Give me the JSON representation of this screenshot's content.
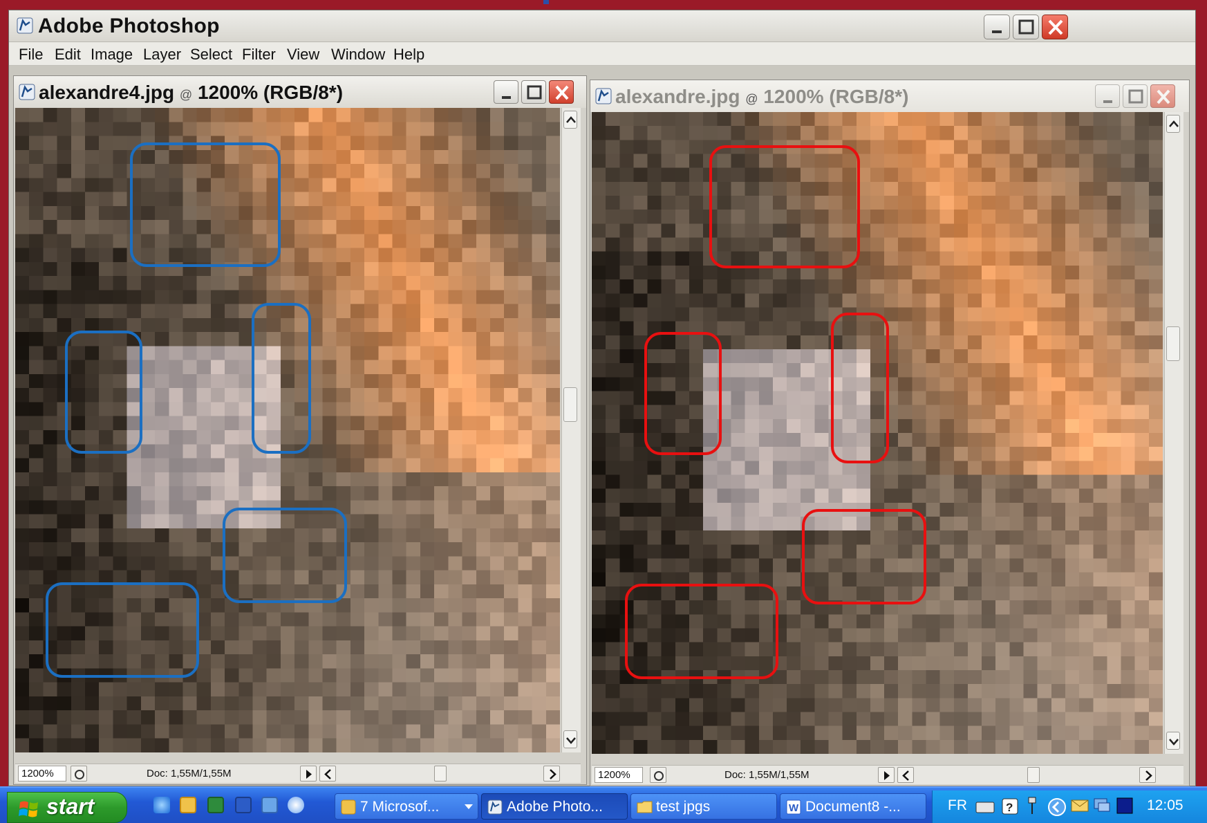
{
  "app": {
    "title": "Adobe Photoshop",
    "menu": [
      "File",
      "Edit",
      "Image",
      "Layer",
      "Select",
      "Filter",
      "View",
      "Window",
      "Help"
    ]
  },
  "documents": [
    {
      "title": "alexandre4.jpg",
      "zoom_label": "1200% (RGB/8*)",
      "zoom": "1200%",
      "doc_info": "Doc: 1,55M/1,55M",
      "highlight_color": "#1b6fc2",
      "active": true
    },
    {
      "title": "alexandre.jpg",
      "zoom_label": "1200% (RGB/8*)",
      "zoom": "1200%",
      "doc_info": "Doc: 1,55M/1,55M",
      "highlight_color": "#e81010",
      "active": false
    }
  ],
  "taskbar": {
    "start_label": "start",
    "quick_launch": [
      "ie-icon",
      "outlook-icon",
      "excel-icon",
      "word-icon",
      "media-icon",
      "back-icon"
    ],
    "buttons": [
      {
        "label": "7 Microsof...",
        "icon": "outlook-icon",
        "count": "7",
        "active": false
      },
      {
        "label": "Adobe Photo...",
        "icon": "photoshop-icon",
        "active": true
      },
      {
        "label": "test jpgs",
        "icon": "folder-icon",
        "active": false
      },
      {
        "label": "Document8 -...",
        "icon": "word-icon",
        "active": false
      }
    ],
    "tray": {
      "language": "FR",
      "clock": "12:05"
    }
  },
  "colors": {
    "accent_frame": "#9a1a28",
    "left_boxes": "#1b6fc2",
    "right_boxes": "#e81010"
  }
}
